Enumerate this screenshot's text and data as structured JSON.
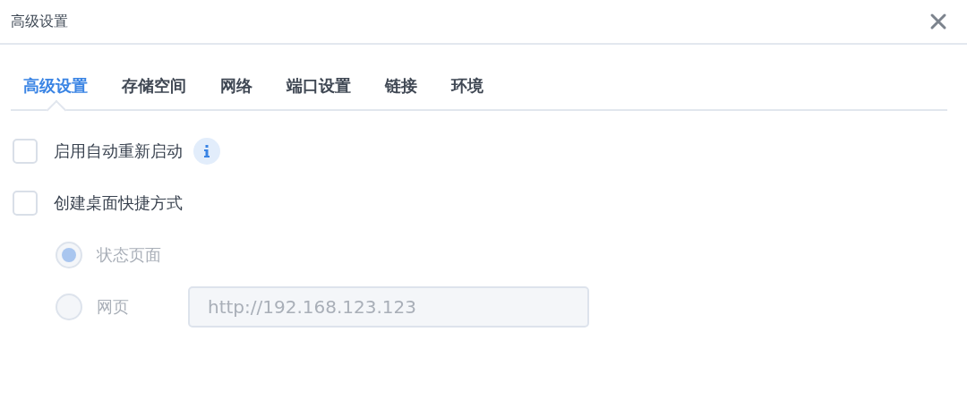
{
  "window": {
    "title": "高级设置"
  },
  "tabs": [
    {
      "label": "高级设置",
      "selected": true
    },
    {
      "label": "存储空间",
      "selected": false
    },
    {
      "label": "网络",
      "selected": false
    },
    {
      "label": "端口设置",
      "selected": false
    },
    {
      "label": "链接",
      "selected": false
    },
    {
      "label": "环境",
      "selected": false
    }
  ],
  "options": [
    {
      "label": "启用自动重新启动",
      "checked": false,
      "info": true
    },
    {
      "label": "创建桌面快捷方式",
      "checked": false,
      "info": false
    }
  ],
  "shortcut_type": {
    "disabled": true,
    "choices": [
      {
        "label": "状态页面",
        "selected": true
      },
      {
        "label": "网页",
        "selected": false
      }
    ],
    "url_field": {
      "value": "http://192.168.123.123"
    }
  }
}
